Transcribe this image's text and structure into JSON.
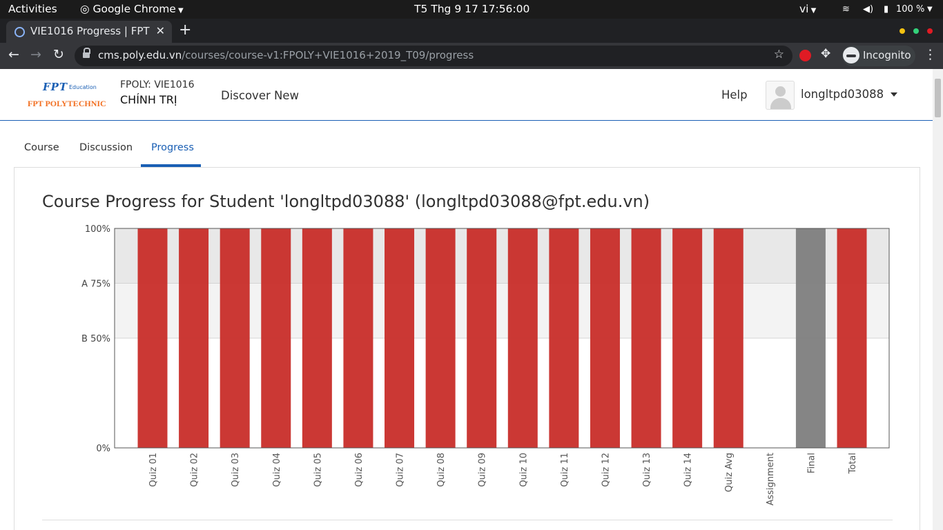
{
  "system_bar": {
    "activities": "Activities",
    "app": "Google Chrome",
    "clock": "T5 Thg 9 17  17:56:00",
    "lang": "vi",
    "battery": "100 %"
  },
  "browser": {
    "tab_title": "VIE1016 Progress | FPT",
    "url_host": "cms.poly.edu.vn",
    "url_path": "/courses/course-v1:FPOLY+VIE1016+2019_T09/progress",
    "incognito_label": "Incognito"
  },
  "header": {
    "logo_fpt": "FPT",
    "logo_education": "Education",
    "logo_poly": "FPT POLYTECHNIC",
    "course_org": "FPOLY: VIE1016",
    "course_name": "CHÍNH TRỊ",
    "discover": "Discover New",
    "help": "Help",
    "username": "longltpd03088"
  },
  "course_tabs": [
    {
      "label": "Course"
    },
    {
      "label": "Discussion"
    },
    {
      "label": "Progress",
      "active": true
    }
  ],
  "main": {
    "title": "Course Progress for Student 'longltpd03088' (longltpd03088@fpt.edu.vn)"
  },
  "colors": {
    "bar": "#c9302c",
    "final_bar": "#808080",
    "accent": "#1a5fb4"
  },
  "chart_data": {
    "type": "bar",
    "categories": [
      "Quiz 01",
      "Quiz 02",
      "Quiz 03",
      "Quiz 04",
      "Quiz 05",
      "Quiz 06",
      "Quiz 07",
      "Quiz 08",
      "Quiz 09",
      "Quiz 10",
      "Quiz 11",
      "Quiz 12",
      "Quiz 13",
      "Quiz 14",
      "Quiz Avg",
      "Assignment",
      "Final",
      "Total"
    ],
    "values": [
      100,
      100,
      100,
      100,
      100,
      100,
      100,
      100,
      100,
      100,
      100,
      100,
      100,
      100,
      100,
      0,
      100,
      100
    ],
    "bar_style": [
      "score",
      "score",
      "score",
      "score",
      "score",
      "score",
      "score",
      "score",
      "score",
      "score",
      "score",
      "score",
      "score",
      "score",
      "score",
      "none",
      "gray",
      "score"
    ],
    "y_ticks": [
      {
        "value": 100,
        "label": "100%"
      },
      {
        "value": 75,
        "label": "A 75%"
      },
      {
        "value": 50,
        "label": "B 50%"
      },
      {
        "value": 0,
        "label": "0%"
      }
    ],
    "grade_bands": [
      {
        "from": 75,
        "to": 100,
        "label": "A"
      },
      {
        "from": 50,
        "to": 75,
        "label": "B"
      }
    ],
    "ylim": [
      0,
      100
    ]
  }
}
